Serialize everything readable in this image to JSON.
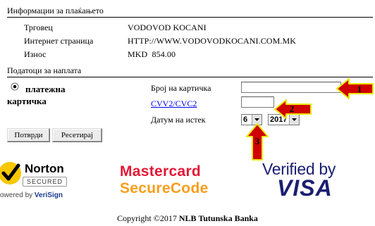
{
  "payment_info": {
    "title": "Информации за плаќањето",
    "rows": [
      {
        "label": "Трговец",
        "value": "VODOVOD KOCANI"
      },
      {
        "label": "Интернет страница",
        "value": "HTTP://WWW.VODOVODKOCANI.COM.MK"
      },
      {
        "label": "Износ",
        "value": "MKD  854.00"
      }
    ]
  },
  "payment_data": {
    "title": "Податоци за наплата",
    "method_label_line1": "платежна",
    "method_label_line2": "картичка",
    "card_number_label": "Број на картичка",
    "card_number_value": "",
    "cvv_label": "CVV2/CVC2",
    "cvv_value": "",
    "expiry_label": "Датум на истек",
    "expiry_month": "6",
    "expiry_year": "2017"
  },
  "buttons": {
    "confirm": "Потврди",
    "reset": "Ресетирај"
  },
  "annotations": {
    "arrow1": "1",
    "arrow2": "2",
    "arrow3": "3",
    "arrow_fill": "#d00000",
    "arrow_stroke": "#e8e800"
  },
  "logos": {
    "norton_name": "Norton",
    "norton_secured": "SECURED",
    "norton_powered": "owered by ",
    "norton_verisign": "VeriSign",
    "mastercard_line1": "Mastercard",
    "mastercard_line2": "SecureCode",
    "visa_line1": "Verified by",
    "visa_line2": "VISA",
    "norton_yellow": "#f7c700",
    "mastercard_red": "#e21836",
    "mastercard_orange": "#f79e1b",
    "visa_blue": "#1a1f71"
  },
  "footer": {
    "prefix": "Copyright ©2017 ",
    "bank": "NLB Tutunska Banka"
  }
}
